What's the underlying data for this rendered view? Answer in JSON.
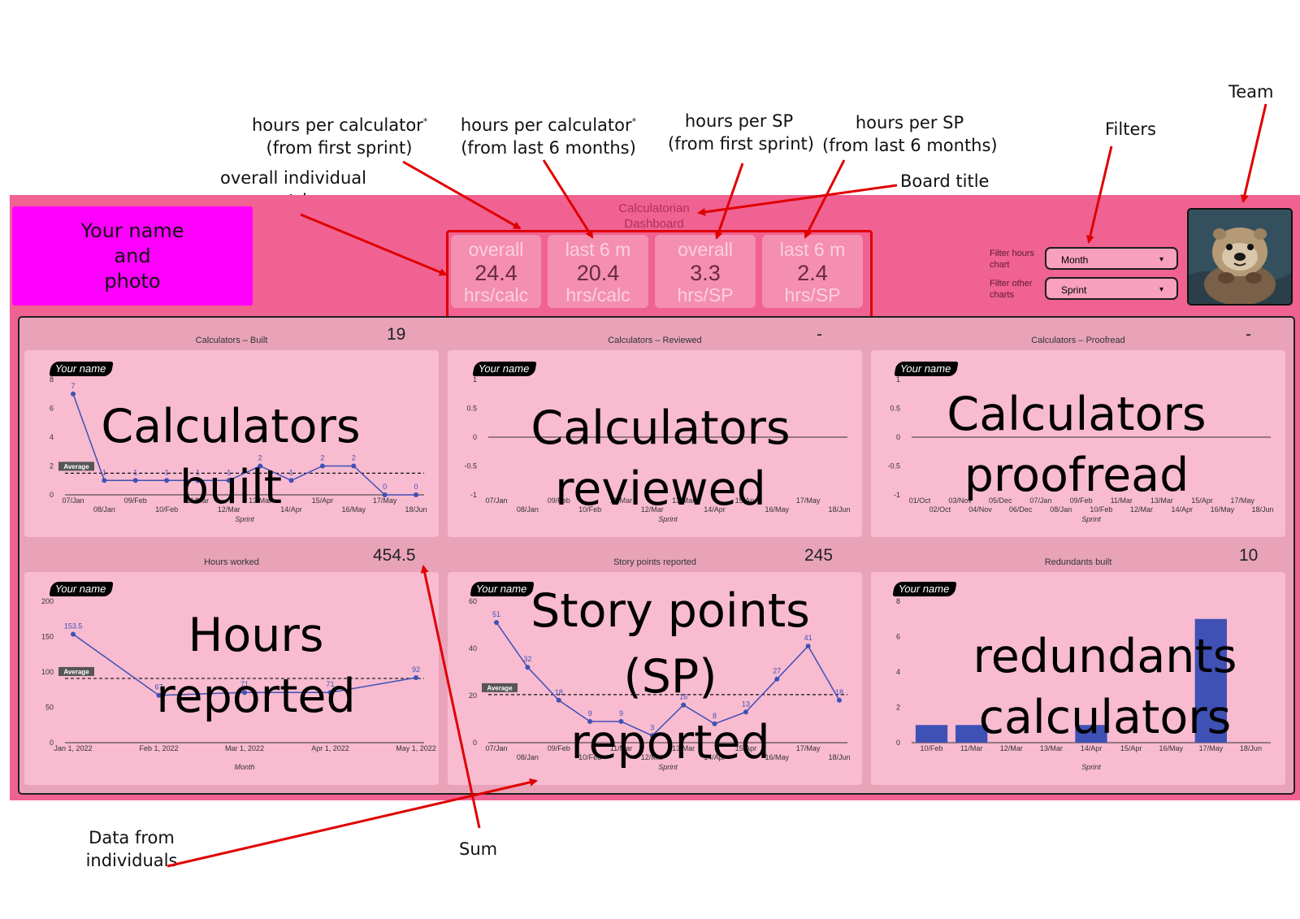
{
  "annotations": {
    "hrs_calc_first": [
      "hours per calculator",
      "(from first sprint)"
    ],
    "hrs_calc_6m": [
      "hours per calculator",
      "(from last 6 months)"
    ],
    "hrs_sp_first": [
      "hours per SP",
      "(from first sprint)"
    ],
    "hrs_sp_6m": [
      "hours per SP",
      "(from last 6 months)"
    ],
    "asterisk": "*",
    "overall_metrics": [
      "overall individual",
      "metrics"
    ],
    "board_title": "Board title",
    "filters": "Filters",
    "team": "Team",
    "data_from_individuals": [
      "Data from",
      "individuals"
    ],
    "sum": "Sum"
  },
  "header": {
    "name_photo": [
      "Your name",
      "and",
      "photo"
    ],
    "board_title": [
      "Calculatorian",
      "Dashboard"
    ]
  },
  "metrics": [
    {
      "label": "overall",
      "value": "24.4",
      "unit": "hrs/calc"
    },
    {
      "label": "last 6 m",
      "value": "20.4",
      "unit": "hrs/calc"
    },
    {
      "label": "overall",
      "value": "3.3",
      "unit": "hrs/SP"
    },
    {
      "label": "last 6 m",
      "value": "2.4",
      "unit": "hrs/SP"
    }
  ],
  "filters": {
    "hours_label": [
      "Filter hours",
      "chart"
    ],
    "hours_value": "Month",
    "other_label": [
      "Filter other",
      "charts"
    ],
    "other_value": "Sprint"
  },
  "cards": {
    "built": {
      "title": "Calculators – Built",
      "total": "19",
      "overlay": [
        "Calculators",
        "built"
      ]
    },
    "reviewed": {
      "title": "Calculators – Reviewed",
      "total": "-",
      "overlay": [
        "Calculators",
        "reviewed"
      ]
    },
    "proofread": {
      "title": "Calculators – Proofread",
      "total": "-",
      "overlay": [
        "Calculators",
        "proofread"
      ]
    },
    "hours": {
      "title": "Hours worked",
      "total": "454.5",
      "overlay": [
        "Hours",
        "reported"
      ]
    },
    "sp": {
      "title": "Story points reported",
      "total": "245",
      "overlay": [
        "Story points",
        "(SP)",
        "reported"
      ]
    },
    "redundants": {
      "title": "Redundants built",
      "total": "10",
      "overlay": [
        "redundants",
        "calculators"
      ]
    }
  },
  "labels": {
    "your_name": "Your name",
    "average": "Average",
    "sprint": "Sprint",
    "month": "Month"
  },
  "colors": {
    "board": "#f06292",
    "line": "#3f51b5",
    "annotation": "#e00000",
    "namebox": "#ff00ff"
  },
  "chart_data": [
    {
      "type": "line",
      "title": "Calculators – Built",
      "xlabel": "Sprint",
      "categories": [
        "07/Jan",
        "08/Jan",
        "09/Feb",
        "10/Feb",
        "11/Mar",
        "12/Mar",
        "13/Mar",
        "14/Apr",
        "15/Apr",
        "16/May",
        "17/May",
        "18/Jun"
      ],
      "values": [
        7,
        1,
        1,
        1,
        1,
        1,
        2,
        1,
        2,
        2,
        0,
        0
      ],
      "ylim": [
        0,
        8
      ],
      "yticks": [
        0,
        2,
        4,
        6,
        8
      ],
      "average": 1.5
    },
    {
      "type": "line",
      "title": "Calculators – Reviewed",
      "xlabel": "Sprint",
      "categories": [
        "07/Jan",
        "08/Jan",
        "09/Feb",
        "10/Feb",
        "11/Mar",
        "12/Mar",
        "13/Mar",
        "14/Apr",
        "15/Apr",
        "16/May",
        "17/May",
        "18/Jun"
      ],
      "values": [],
      "ylim": [
        -1,
        1
      ],
      "yticks": [
        -1,
        -0.5,
        0,
        0.5,
        1
      ]
    },
    {
      "type": "line",
      "title": "Calculators – Proofread",
      "xlabel": "Sprint",
      "categories": [
        "01/Oct",
        "02/Oct",
        "03/Nov",
        "04/Nov",
        "05/Dec",
        "06/Dec",
        "07/Jan",
        "08/Jan",
        "09/Feb",
        "10/Feb",
        "11/Mar",
        "12/Mar",
        "13/Mar",
        "14/Apr",
        "15/Apr",
        "16/May",
        "17/May",
        "18/Jun"
      ],
      "values": [],
      "ylim": [
        -1,
        1
      ],
      "yticks": [
        -1,
        -0.5,
        0,
        0.5,
        1
      ]
    },
    {
      "type": "line",
      "title": "Hours worked",
      "xlabel": "Month",
      "categories": [
        "Jan 1, 2022",
        "Feb 1, 2022",
        "Mar 1, 2022",
        "Apr 1, 2022",
        "May 1, 2022"
      ],
      "values": [
        153.5,
        67,
        71,
        71,
        92
      ],
      "ylim": [
        0,
        200
      ],
      "yticks": [
        0,
        50,
        100,
        150,
        200
      ],
      "average": 90.9
    },
    {
      "type": "line",
      "title": "Story points reported",
      "xlabel": "Sprint",
      "categories": [
        "07/Jan",
        "08/Jan",
        "09/Feb",
        "10/Feb",
        "11/Mar",
        "12/Mar",
        "13/Mar",
        "14/Apr",
        "15/Apr",
        "16/May",
        "17/May",
        "18/Jun"
      ],
      "values": [
        51,
        32,
        18,
        9,
        9,
        3,
        16,
        8,
        13,
        27,
        41,
        18
      ],
      "ylim": [
        0,
        60
      ],
      "yticks": [
        0,
        20,
        40,
        60
      ],
      "average": 20.4
    },
    {
      "type": "bar",
      "title": "Redundants built",
      "xlabel": "Sprint",
      "categories": [
        "10/Feb",
        "11/Mar",
        "12/Mar",
        "13/Mar",
        "14/Apr",
        "15/Apr",
        "16/May",
        "17/May",
        "18/Jun"
      ],
      "values": [
        1,
        1,
        0,
        0,
        1,
        0,
        0,
        7,
        0
      ],
      "ylim": [
        0,
        8
      ],
      "yticks": [
        0,
        2,
        4,
        6,
        8
      ]
    }
  ]
}
